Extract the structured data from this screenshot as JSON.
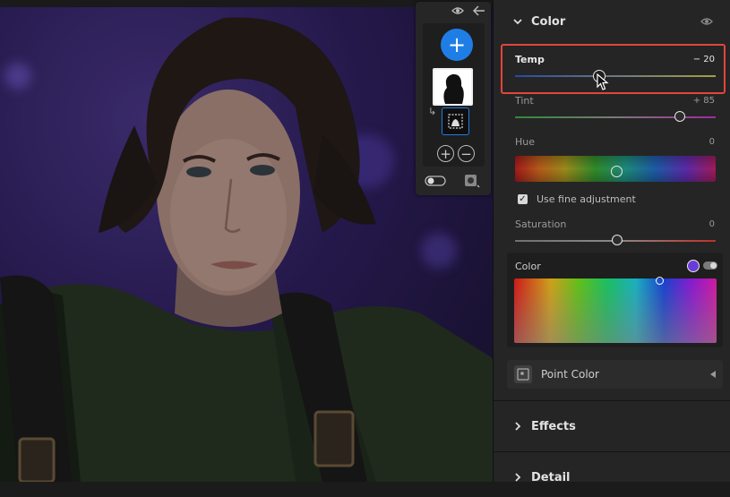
{
  "masks_panel": {
    "add_label": "+",
    "add_mask_label": "+",
    "subtract_mask_label": "−"
  },
  "color_section": {
    "title": "Color",
    "temp": {
      "label": "Temp",
      "value": "− 20",
      "level": -20
    },
    "tint": {
      "label": "Tint",
      "value": "+ 85",
      "level": 85
    },
    "hue": {
      "label": "Hue",
      "value": "0",
      "level": 0
    },
    "fine_adjustment": {
      "label": "Use fine adjustment",
      "checked": true
    },
    "saturation": {
      "label": "Saturation",
      "value": "0",
      "level": 0
    },
    "color_picker": {
      "label": "Color",
      "swatch_color": "#6a3bd8"
    },
    "point_color": {
      "label": "Point Color"
    }
  },
  "effects_section": {
    "title": "Effects"
  },
  "detail_section": {
    "title": "Detail"
  },
  "colors": {
    "accent_blue": "#1f7ee6",
    "highlight_red": "#e0463c",
    "panel_bg": "#252525"
  }
}
